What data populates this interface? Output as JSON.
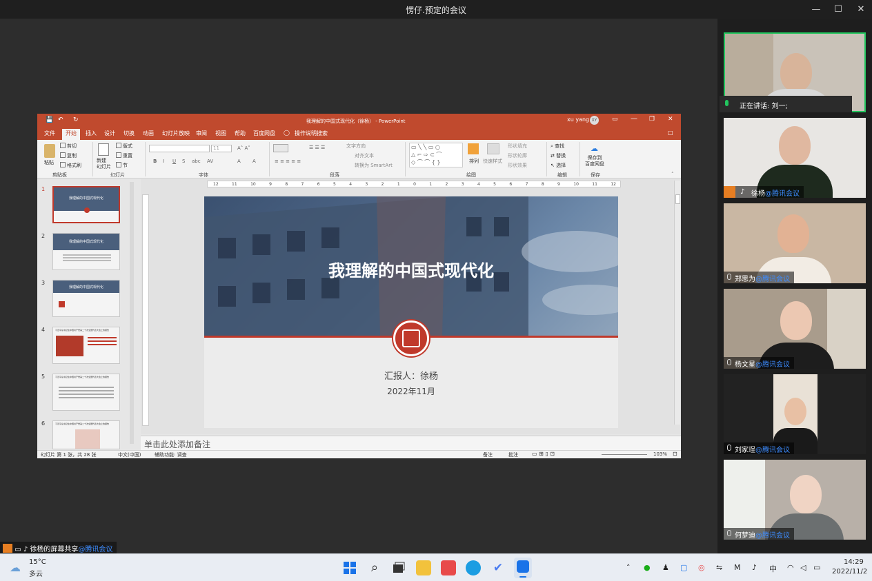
{
  "window": {
    "title": "愣仔.预定的会议",
    "minimize": "—",
    "maximize": "☐",
    "close": "✕"
  },
  "ppt": {
    "doc_title": "我理解的中国式现代化（徐杨） - PowerPoint",
    "user": "xu yang",
    "user_initials": "XY",
    "tabs": [
      "文件",
      "开始",
      "插入",
      "设计",
      "切换",
      "动画",
      "幻灯片放映",
      "审阅",
      "视图",
      "帮助",
      "百度网盘",
      "操作说明搜索"
    ],
    "ribbon": {
      "clipboard": {
        "paste": "粘贴",
        "cut": "剪切",
        "copy": "复制",
        "format_painter": "格式刷",
        "group": "剪贴板"
      },
      "slides": {
        "new": "新建\n幻灯片",
        "layout": "版式",
        "reset": "重置",
        "section": "节",
        "group": "幻灯片"
      },
      "font": {
        "size": "11",
        "group": "字体"
      },
      "paragraph": {
        "text_dir": "文字方向",
        "align": "对齐文本",
        "smartart": "转换为 SmartArt",
        "group": "段落"
      },
      "drawing": {
        "arrange": "排列",
        "quick_styles": "快速样式",
        "fill": "形状填充",
        "outline": "形状轮廓",
        "effects": "形状效果",
        "group": "绘图"
      },
      "editing": {
        "find": "查找",
        "replace": "替换",
        "select": "选择",
        "group": "编辑"
      },
      "save": {
        "save_to": "保存到\n百度网盘",
        "group": "保存"
      }
    },
    "ruler_ticks": [
      "12",
      "11",
      "10",
      "9",
      "8",
      "7",
      "6",
      "5",
      "4",
      "3",
      "2",
      "1",
      "0",
      "1",
      "2",
      "3",
      "4",
      "5",
      "6",
      "7",
      "8",
      "9",
      "10",
      "11",
      "12"
    ],
    "thumbnails": [
      {
        "num": "1",
        "title": "我理解的中国式现代化"
      },
      {
        "num": "2",
        "title": "我理解的中国式现代化"
      },
      {
        "num": "3",
        "title": "我理解的中国式现代化"
      },
      {
        "num": "4",
        "title": "习近平总书记在中国共产党第二十次全国代表大会上的报告"
      },
      {
        "num": "5",
        "title": "习近平总书记在中国共产党第二十次全国代表大会上的报告"
      },
      {
        "num": "6",
        "title": "习近平总书记在中国共产党第二十次全国代表大会上的报告"
      }
    ],
    "slide": {
      "title": "我理解的中国式现代化",
      "reporter": "汇报人：徐杨",
      "date": "2022年11月"
    },
    "notes_placeholder": "单击此处添加备注",
    "status": {
      "slide_count": "幻灯片 第 1 张，共 28 张",
      "language": "中文(中国)",
      "accessibility": "辅助功能: 调查",
      "notes": "备注",
      "comments": "批注",
      "zoom": "103%"
    }
  },
  "meeting": {
    "speaking_label": "正在讲话: 刘一;",
    "share_label": "徐杨的屏幕共享",
    "org": "@腾讯会议",
    "participants": [
      {
        "name": "",
        "org": ""
      },
      {
        "name": "徐杨",
        "org": "@腾讯会议"
      },
      {
        "name": "郑思为",
        "org": "@腾讯会议"
      },
      {
        "name": "杨文星",
        "org": "@腾讯会议"
      },
      {
        "name": "刘家珵",
        "org": "@腾讯会议"
      },
      {
        "name": "何梦迪",
        "org": "@腾讯会议"
      }
    ]
  },
  "taskbar": {
    "weather_temp": "15°C",
    "weather_desc": "多云",
    "ime": "中",
    "time": "14:29",
    "date": "2022/11/2"
  },
  "colors": {
    "ppt_accent": "#c04a2e",
    "meeting_link": "#3d8cff",
    "active_speaker": "#22c55e"
  }
}
